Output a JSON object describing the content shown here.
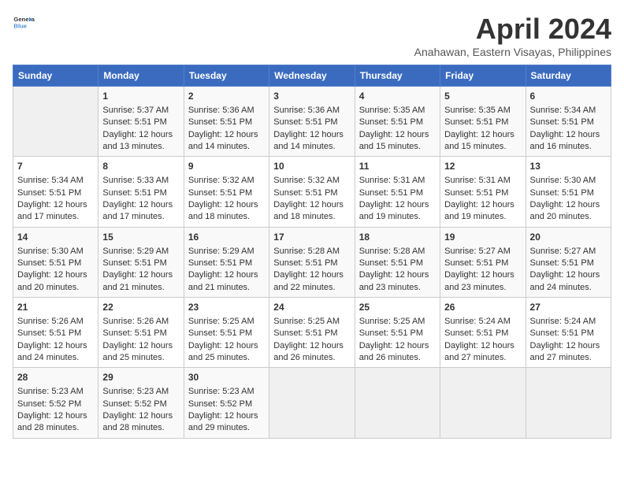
{
  "header": {
    "logo_line1": "General",
    "logo_line2": "Blue",
    "month": "April 2024",
    "location": "Anahawan, Eastern Visayas, Philippines"
  },
  "weekdays": [
    "Sunday",
    "Monday",
    "Tuesday",
    "Wednesday",
    "Thursday",
    "Friday",
    "Saturday"
  ],
  "weeks": [
    [
      {
        "day": "",
        "info": ""
      },
      {
        "day": "1",
        "info": "Sunrise: 5:37 AM\nSunset: 5:51 PM\nDaylight: 12 hours\nand 13 minutes."
      },
      {
        "day": "2",
        "info": "Sunrise: 5:36 AM\nSunset: 5:51 PM\nDaylight: 12 hours\nand 14 minutes."
      },
      {
        "day": "3",
        "info": "Sunrise: 5:36 AM\nSunset: 5:51 PM\nDaylight: 12 hours\nand 14 minutes."
      },
      {
        "day": "4",
        "info": "Sunrise: 5:35 AM\nSunset: 5:51 PM\nDaylight: 12 hours\nand 15 minutes."
      },
      {
        "day": "5",
        "info": "Sunrise: 5:35 AM\nSunset: 5:51 PM\nDaylight: 12 hours\nand 15 minutes."
      },
      {
        "day": "6",
        "info": "Sunrise: 5:34 AM\nSunset: 5:51 PM\nDaylight: 12 hours\nand 16 minutes."
      }
    ],
    [
      {
        "day": "7",
        "info": "Sunrise: 5:34 AM\nSunset: 5:51 PM\nDaylight: 12 hours\nand 17 minutes."
      },
      {
        "day": "8",
        "info": "Sunrise: 5:33 AM\nSunset: 5:51 PM\nDaylight: 12 hours\nand 17 minutes."
      },
      {
        "day": "9",
        "info": "Sunrise: 5:32 AM\nSunset: 5:51 PM\nDaylight: 12 hours\nand 18 minutes."
      },
      {
        "day": "10",
        "info": "Sunrise: 5:32 AM\nSunset: 5:51 PM\nDaylight: 12 hours\nand 18 minutes."
      },
      {
        "day": "11",
        "info": "Sunrise: 5:31 AM\nSunset: 5:51 PM\nDaylight: 12 hours\nand 19 minutes."
      },
      {
        "day": "12",
        "info": "Sunrise: 5:31 AM\nSunset: 5:51 PM\nDaylight: 12 hours\nand 19 minutes."
      },
      {
        "day": "13",
        "info": "Sunrise: 5:30 AM\nSunset: 5:51 PM\nDaylight: 12 hours\nand 20 minutes."
      }
    ],
    [
      {
        "day": "14",
        "info": "Sunrise: 5:30 AM\nSunset: 5:51 PM\nDaylight: 12 hours\nand 20 minutes."
      },
      {
        "day": "15",
        "info": "Sunrise: 5:29 AM\nSunset: 5:51 PM\nDaylight: 12 hours\nand 21 minutes."
      },
      {
        "day": "16",
        "info": "Sunrise: 5:29 AM\nSunset: 5:51 PM\nDaylight: 12 hours\nand 21 minutes."
      },
      {
        "day": "17",
        "info": "Sunrise: 5:28 AM\nSunset: 5:51 PM\nDaylight: 12 hours\nand 22 minutes."
      },
      {
        "day": "18",
        "info": "Sunrise: 5:28 AM\nSunset: 5:51 PM\nDaylight: 12 hours\nand 23 minutes."
      },
      {
        "day": "19",
        "info": "Sunrise: 5:27 AM\nSunset: 5:51 PM\nDaylight: 12 hours\nand 23 minutes."
      },
      {
        "day": "20",
        "info": "Sunrise: 5:27 AM\nSunset: 5:51 PM\nDaylight: 12 hours\nand 24 minutes."
      }
    ],
    [
      {
        "day": "21",
        "info": "Sunrise: 5:26 AM\nSunset: 5:51 PM\nDaylight: 12 hours\nand 24 minutes."
      },
      {
        "day": "22",
        "info": "Sunrise: 5:26 AM\nSunset: 5:51 PM\nDaylight: 12 hours\nand 25 minutes."
      },
      {
        "day": "23",
        "info": "Sunrise: 5:25 AM\nSunset: 5:51 PM\nDaylight: 12 hours\nand 25 minutes."
      },
      {
        "day": "24",
        "info": "Sunrise: 5:25 AM\nSunset: 5:51 PM\nDaylight: 12 hours\nand 26 minutes."
      },
      {
        "day": "25",
        "info": "Sunrise: 5:25 AM\nSunset: 5:51 PM\nDaylight: 12 hours\nand 26 minutes."
      },
      {
        "day": "26",
        "info": "Sunrise: 5:24 AM\nSunset: 5:51 PM\nDaylight: 12 hours\nand 27 minutes."
      },
      {
        "day": "27",
        "info": "Sunrise: 5:24 AM\nSunset: 5:51 PM\nDaylight: 12 hours\nand 27 minutes."
      }
    ],
    [
      {
        "day": "28",
        "info": "Sunrise: 5:23 AM\nSunset: 5:52 PM\nDaylight: 12 hours\nand 28 minutes."
      },
      {
        "day": "29",
        "info": "Sunrise: 5:23 AM\nSunset: 5:52 PM\nDaylight: 12 hours\nand 28 minutes."
      },
      {
        "day": "30",
        "info": "Sunrise: 5:23 AM\nSunset: 5:52 PM\nDaylight: 12 hours\nand 29 minutes."
      },
      {
        "day": "",
        "info": ""
      },
      {
        "day": "",
        "info": ""
      },
      {
        "day": "",
        "info": ""
      },
      {
        "day": "",
        "info": ""
      }
    ]
  ]
}
